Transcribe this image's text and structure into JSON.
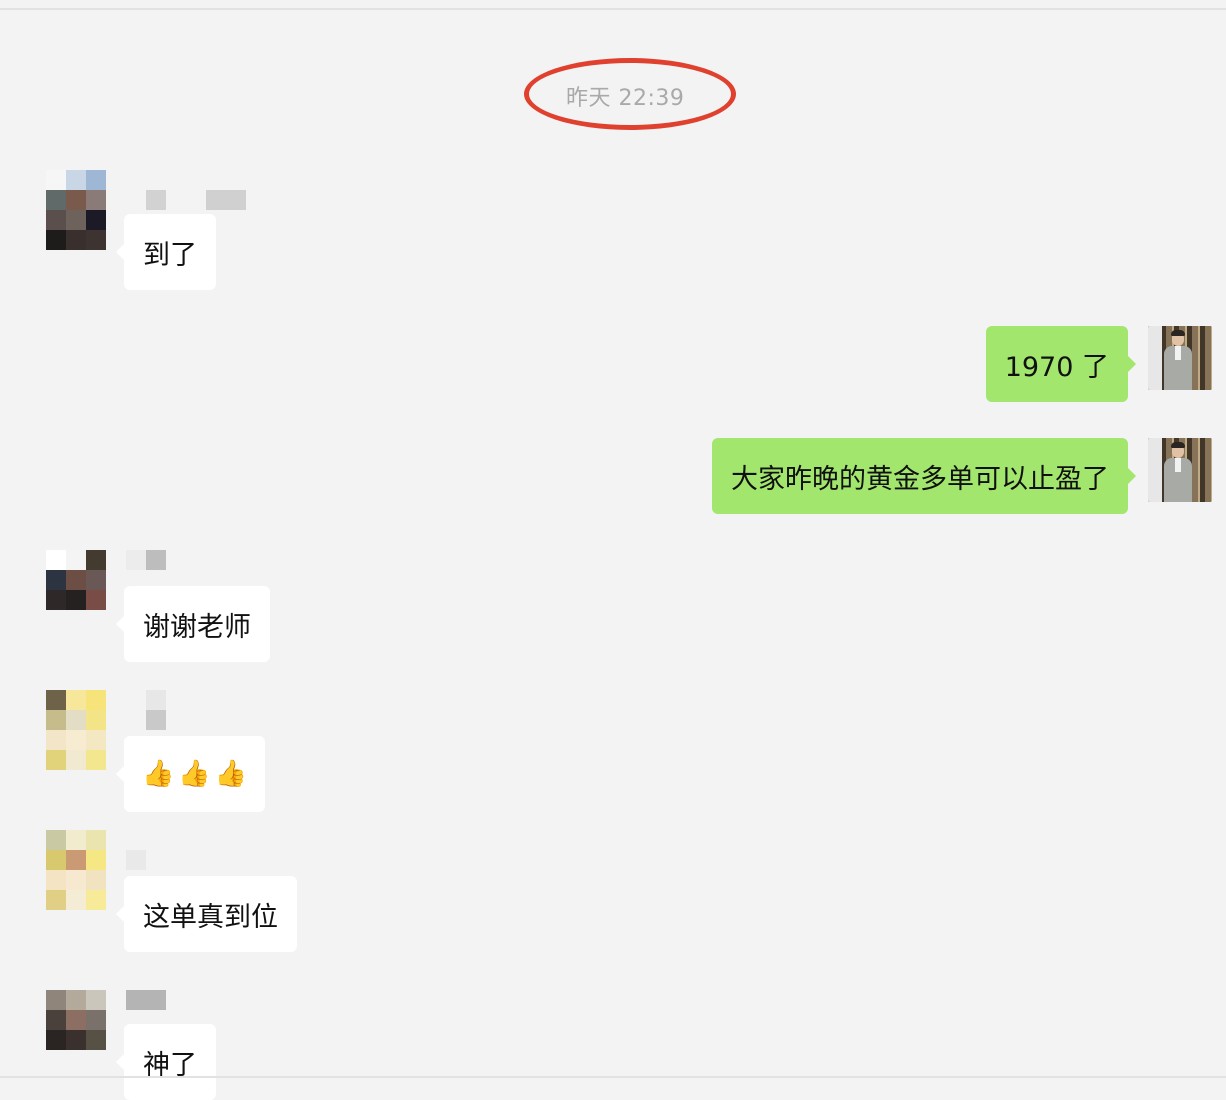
{
  "chat": {
    "timestamp": "昨天 22:39",
    "messages": [
      {
        "side": "in",
        "text": "到了"
      },
      {
        "side": "out",
        "text": "1970 了"
      },
      {
        "side": "out",
        "text": "大家昨晚的黄金多单可以止盈了"
      },
      {
        "side": "in",
        "text": "谢谢老师"
      },
      {
        "side": "in",
        "emoji": [
          "thumbs-up-icon",
          "thumbs-up-icon",
          "thumbs-up-icon"
        ]
      },
      {
        "side": "in",
        "text": "这单真到位"
      },
      {
        "side": "in",
        "text": "神了"
      }
    ]
  },
  "colors": {
    "background": "#f3f3f3",
    "incoming_bubble": "#ffffff",
    "outgoing_bubble": "#a3e66e",
    "timestamp_text": "#a9a9a9",
    "highlight_ring": "#e0412f"
  }
}
